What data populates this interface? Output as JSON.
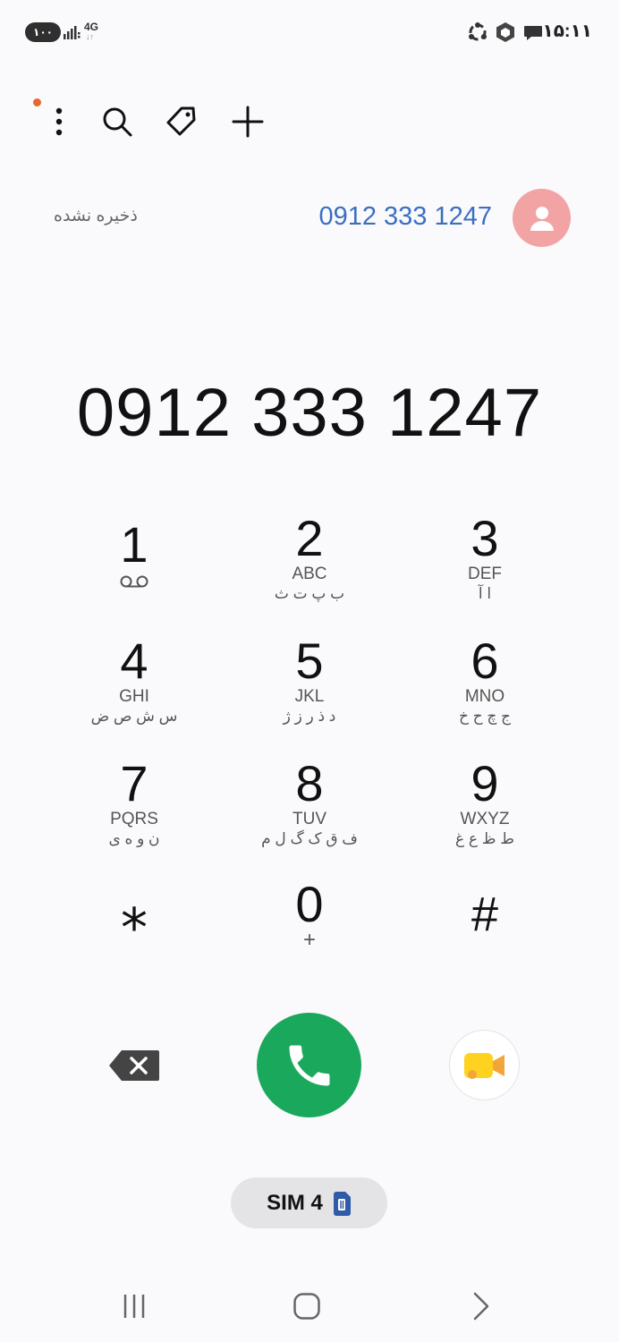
{
  "status_bar": {
    "battery": "۱۰۰",
    "network_type": "4G",
    "time": "۱۵:۱۱"
  },
  "toolbar": {
    "icons": [
      "more-vertical-icon",
      "search-icon",
      "tag-icon",
      "plus-icon"
    ]
  },
  "suggestion": {
    "label": "ذخیره نشده",
    "number": "0912 333 1247"
  },
  "dialed_number": "0912 333 1247",
  "keypad": {
    "k1": {
      "digit": "1"
    },
    "k2": {
      "digit": "2",
      "letters": "ABC",
      "persian": "ب پ ت ث"
    },
    "k3": {
      "digit": "3",
      "letters": "DEF",
      "persian": "ا آ"
    },
    "k4": {
      "digit": "4",
      "letters": "GHI",
      "persian": "س ش ص ض"
    },
    "k5": {
      "digit": "5",
      "letters": "JKL",
      "persian": "د ذ ر ز ژ"
    },
    "k6": {
      "digit": "6",
      "letters": "MNO",
      "persian": "ج چ ح خ"
    },
    "k7": {
      "digit": "7",
      "letters": "PQRS",
      "persian": "ن و ه ی"
    },
    "k8": {
      "digit": "8",
      "letters": "TUV",
      "persian": "ف ق ک گ ل م"
    },
    "k9": {
      "digit": "9",
      "letters": "WXYZ",
      "persian": "ط ظ ع غ"
    },
    "kstar": {
      "digit": "⁎"
    },
    "k0": {
      "digit": "0",
      "sub": "+"
    },
    "khash": {
      "digit": "#"
    }
  },
  "sim": {
    "label": "SIM 4"
  },
  "colors": {
    "call": "#1aa95c",
    "accent_blue": "#3b6fbf",
    "avatar": "#f2a3a4",
    "notification_dot": "#e8672c"
  }
}
